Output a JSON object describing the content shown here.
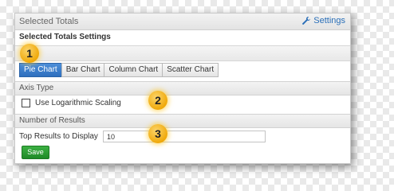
{
  "panel": {
    "title": "Selected Totals",
    "settings_label": "Settings",
    "subtitle": "Selected Totals Settings"
  },
  "chart_types": [
    {
      "label": "Pie Chart",
      "active": true
    },
    {
      "label": "Bar Chart",
      "active": false
    },
    {
      "label": "Column Chart",
      "active": false
    },
    {
      "label": "Scatter Chart",
      "active": false
    }
  ],
  "axis": {
    "header": "Axis Type",
    "log_label": "Use Logarithmic Scaling",
    "log_checked": false
  },
  "results": {
    "header": "Number of Results",
    "top_label": "Top Results to Display",
    "top_value": "10"
  },
  "save_label": "Save",
  "callouts": [
    "1",
    "2",
    "3"
  ],
  "colors": {
    "accent": "#2e6fbe",
    "save": "#1f8a27",
    "callout": "#f0a90a"
  },
  "icons": {
    "settings": "wrench-icon"
  }
}
